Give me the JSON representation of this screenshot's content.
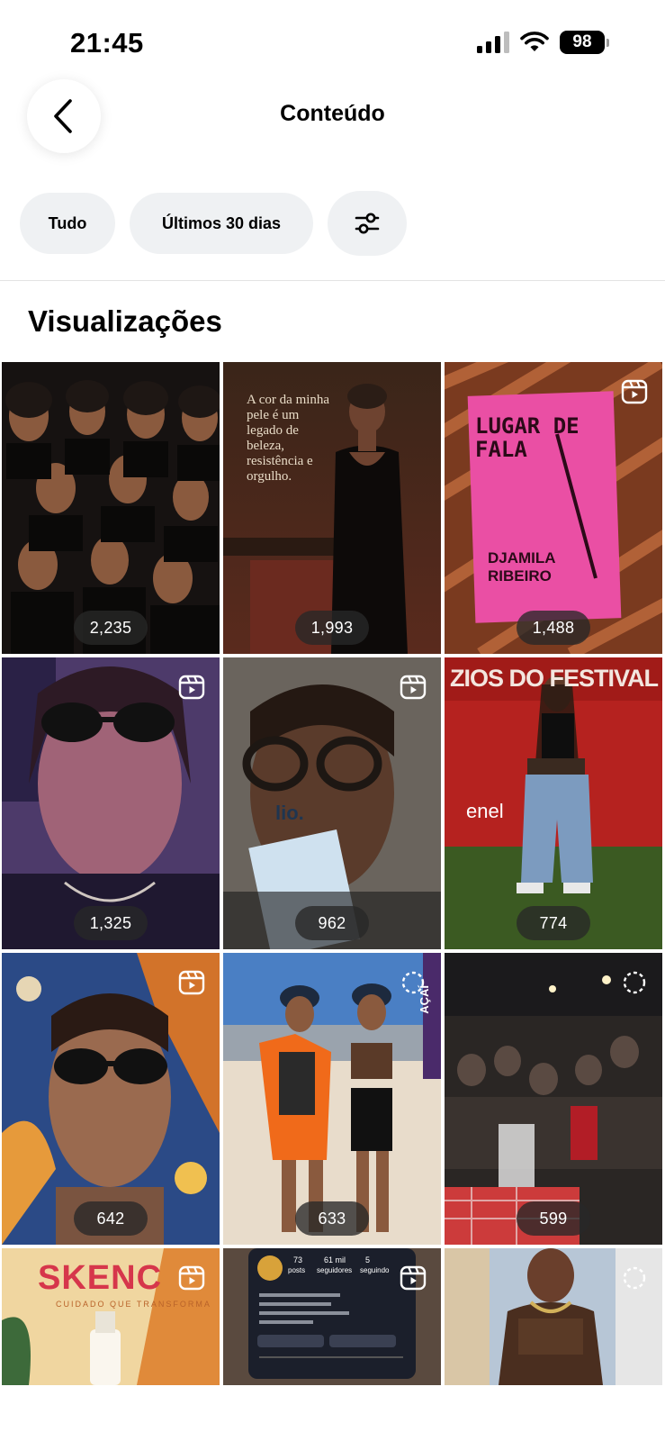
{
  "status_bar": {
    "time": "21:45",
    "battery": "98"
  },
  "header": {
    "title": "Conteúdo"
  },
  "filters": {
    "all_label": "Tudo",
    "range_label": "Últimos 30 dias"
  },
  "section": {
    "title": "Visualizações"
  },
  "icons": {
    "back": "chevron-left-icon",
    "filter": "sliders-icon",
    "reel": "reels-icon",
    "carousel": "loading-ring-icon"
  },
  "posts": [
    {
      "count": "2,235",
      "badge": "",
      "text": ""
    },
    {
      "count": "1,993",
      "badge": "",
      "text": "A cor da minha pele é um legado de beleza, resistência e orgulho."
    },
    {
      "count": "1,488",
      "badge": "reel",
      "title": "LUGAR DE FALA",
      "author": "DJAMILA RIBEIRO"
    },
    {
      "count": "1,325",
      "badge": "reel"
    },
    {
      "count": "962",
      "badge": "reel",
      "label": "lio."
    },
    {
      "count": "774",
      "badge": "",
      "title": "ZIOS DO FESTIVAL",
      "brand": "enel"
    },
    {
      "count": "642",
      "badge": "reel"
    },
    {
      "count": "633",
      "badge": "loading",
      "label": "AÇAÍ"
    },
    {
      "count": "599",
      "badge": "loading"
    },
    {
      "count": "",
      "badge": "reel",
      "title": "SKENC",
      "subtitle": "CUIDADO QUE TRANSFORMA"
    },
    {
      "count": "",
      "badge": "reel",
      "stats": [
        "73",
        "61 mil",
        "5"
      ],
      "statlabels": [
        "posts",
        "seguidores",
        "seguindo"
      ]
    },
    {
      "count": "",
      "badge": "loading"
    }
  ]
}
